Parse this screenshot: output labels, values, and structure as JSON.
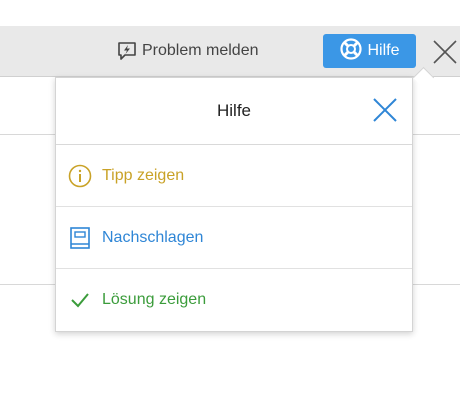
{
  "toolbar": {
    "report_label": "Problem melden",
    "report_icon": "lightning-speech-icon",
    "help_label": "Hilfe",
    "help_icon": "lifebuoy-icon",
    "close_icon": "close-icon"
  },
  "help_panel": {
    "title": "Hilfe",
    "close_icon": "close-icon",
    "items": [
      {
        "label": "Tipp zeigen",
        "icon": "info-circle-icon",
        "color": "#c9a227"
      },
      {
        "label": "Nachschlagen",
        "icon": "book-icon",
        "color": "#2f86d6"
      },
      {
        "label": "Lösung zeigen",
        "icon": "checkmark-icon",
        "color": "#3b9c3b"
      }
    ]
  },
  "colors": {
    "accent": "#3b97e6",
    "toolbar_bg": "#e9e9e9"
  }
}
